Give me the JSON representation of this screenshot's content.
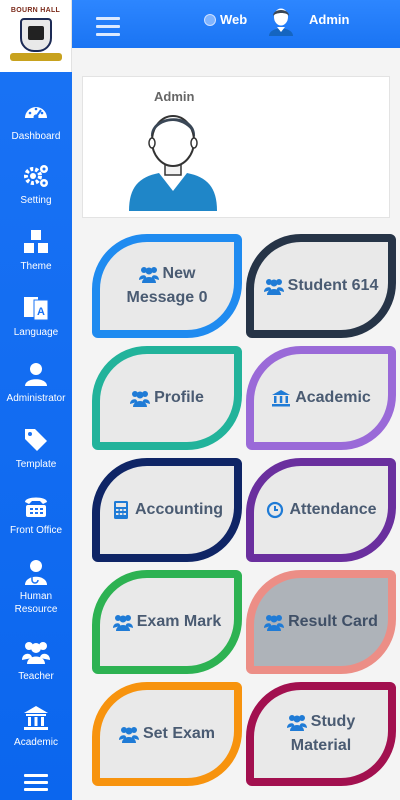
{
  "sidebar": {
    "logo_text": "BOURN HALL",
    "items": [
      {
        "label": "Dashboard",
        "icon": "dashboard-icon"
      },
      {
        "label": "Setting",
        "icon": "gears-icon"
      },
      {
        "label": "Theme",
        "icon": "cubes-icon"
      },
      {
        "label": "Language",
        "icon": "language-icon"
      },
      {
        "label": "Administrator",
        "icon": "user-icon"
      },
      {
        "label": "Template",
        "icon": "tags-icon"
      },
      {
        "label": "Front Office",
        "icon": "fax-icon"
      },
      {
        "label": "Human Resource",
        "icon": "user-md-icon"
      },
      {
        "label": "Teacher",
        "icon": "users-icon"
      },
      {
        "label": "Academic",
        "icon": "bank-icon"
      }
    ]
  },
  "topbar": {
    "web_label": "Web",
    "admin_label": "Admin"
  },
  "profile": {
    "name": "Admin"
  },
  "tiles": [
    {
      "label": "New Message 0",
      "line1": "New",
      "line2": "Message 0",
      "icon": "users-icon",
      "border": "#1f8bf0",
      "bg": "#e9e9e9"
    },
    {
      "label": "Student 614",
      "icon": "users-icon",
      "border": "#263447",
      "bg": "#e9e9e9"
    },
    {
      "label": "Profile",
      "icon": "users-icon",
      "border": "#22b39b",
      "bg": "#e9e9e9"
    },
    {
      "label": "Academic",
      "icon": "bank-icon",
      "border": "#9a6ad8",
      "bg": "#e9e9e9"
    },
    {
      "label": "Accounting",
      "icon": "calculator-icon",
      "border": "#0f2566",
      "bg": "#e9e9e9"
    },
    {
      "label": "Attendance",
      "icon": "clock-icon",
      "border": "#6a2f9e",
      "bg": "#e9e9e9"
    },
    {
      "label": "Exam Mark",
      "icon": "users-icon",
      "border": "#2db252",
      "bg": "#e9e9e9"
    },
    {
      "label": "Result Card",
      "icon": "users-icon",
      "border": "#ec8e86",
      "bg": "#aeb3b9"
    },
    {
      "label": "Set Exam",
      "icon": "users-icon",
      "border": "#f7930e",
      "bg": "#e9e9e9"
    },
    {
      "label": "Study Material",
      "line1": "Study",
      "line2": "Material",
      "icon": "users-icon",
      "border": "#a2104f",
      "bg": "#e9e9e9"
    }
  ]
}
